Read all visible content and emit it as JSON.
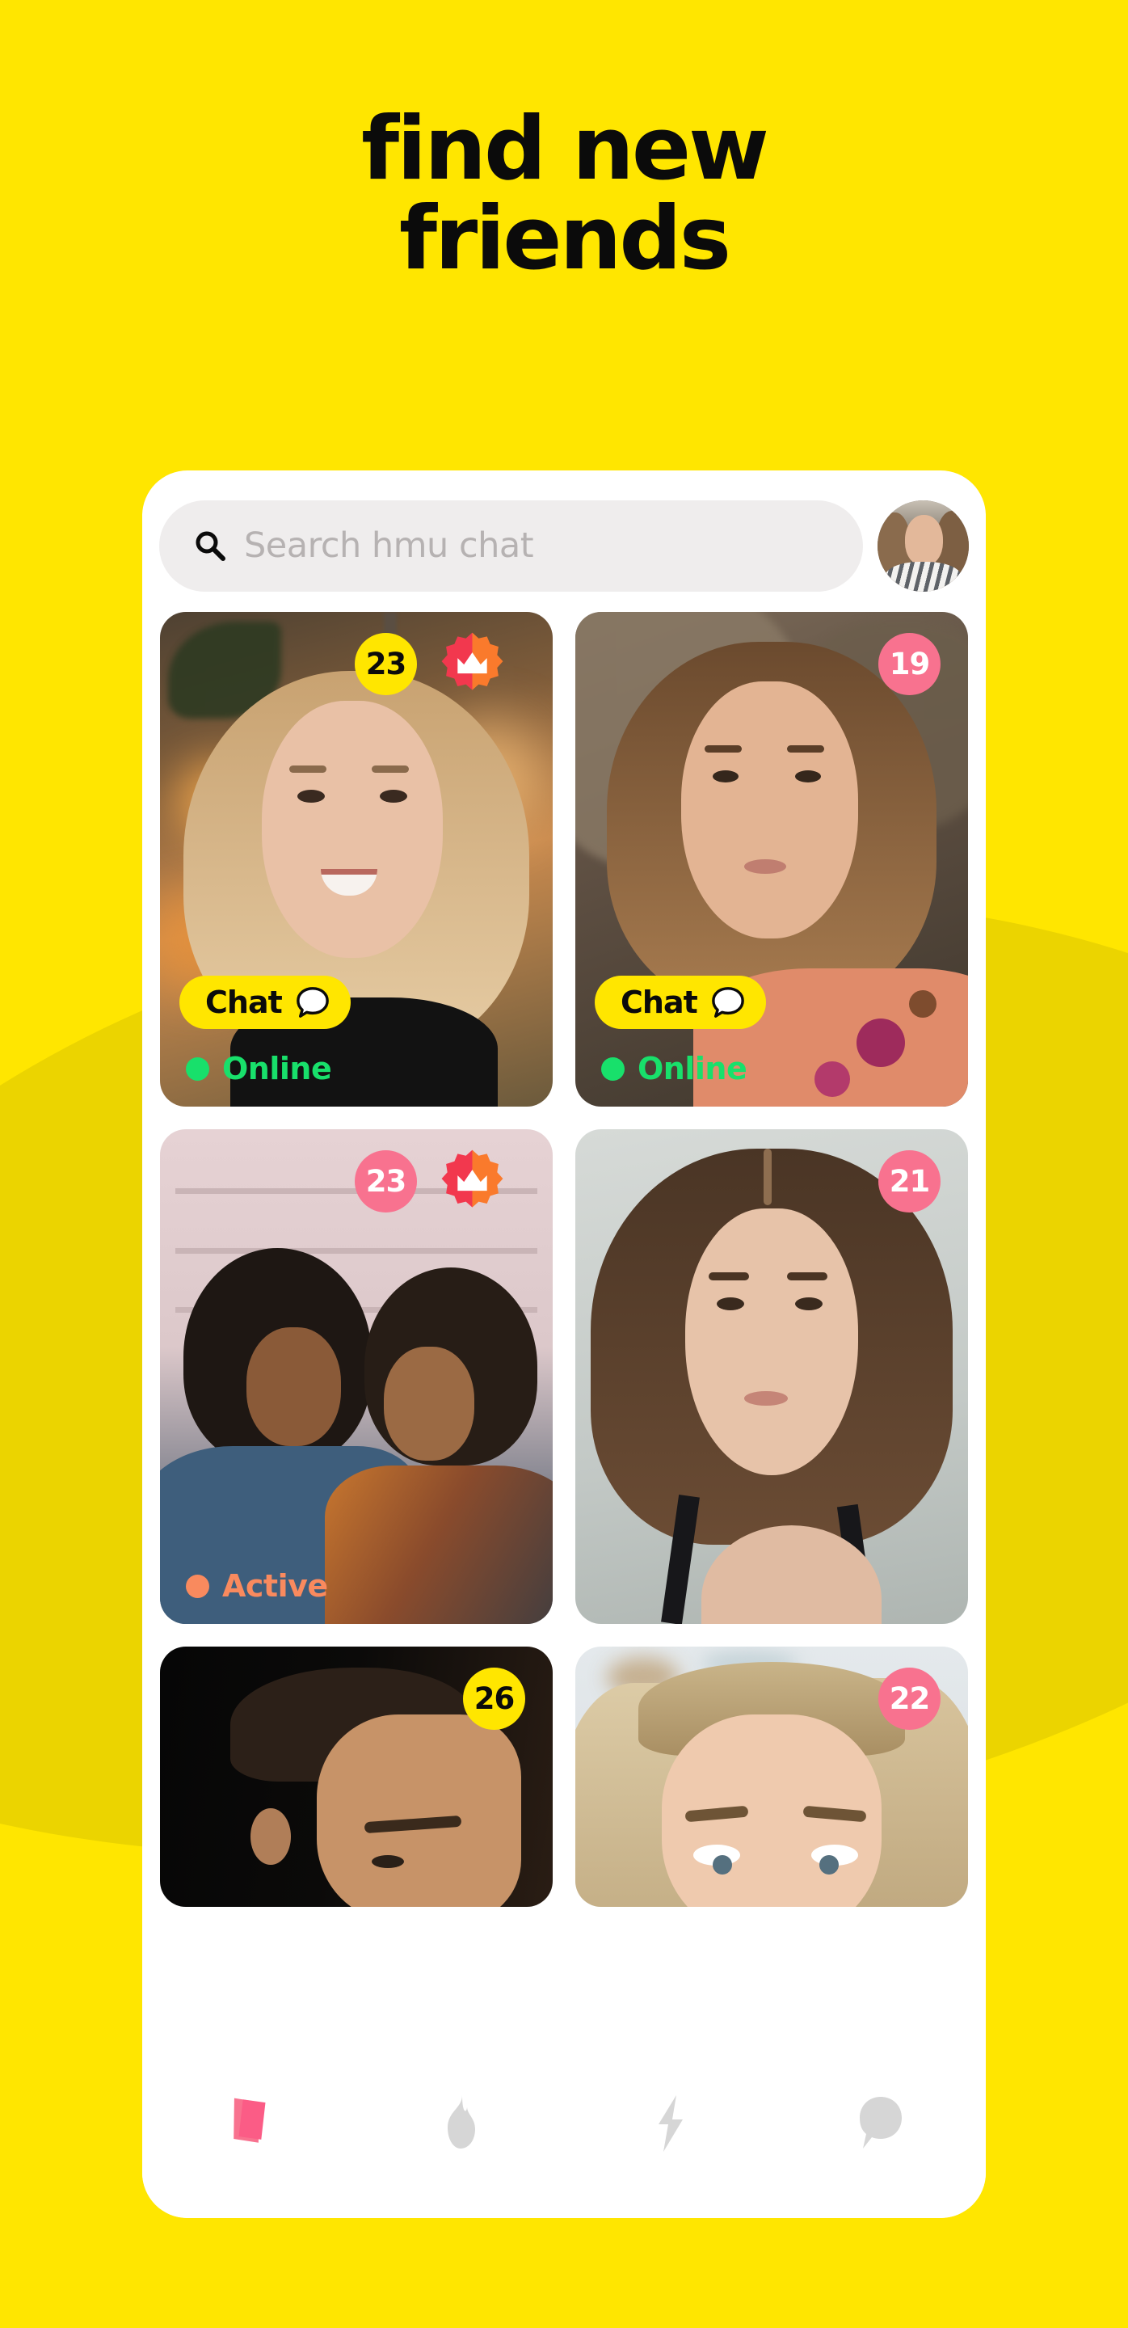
{
  "theme": {
    "background": "#FFE600",
    "background_blob": "#EBD400",
    "card_surface": "#FFFFFF",
    "accent_yellow": "#FFE600",
    "accent_pink": "#F8728F",
    "online_green": "#18E06B",
    "active_orange": "#F98A5E",
    "text_dark": "#0B0B0B",
    "placeholder_grey": "#B6B2B2",
    "search_field_bg": "#EFEDED",
    "nav_inactive": "#D6D6D6",
    "nav_active_pink": "#F8728F"
  },
  "headline": {
    "line1": "find new",
    "line2": "friends"
  },
  "search": {
    "icon": "search-icon",
    "placeholder": "Search hmu chat",
    "value": ""
  },
  "profile_avatar": {
    "icon": "avatar"
  },
  "chat_button": {
    "label": "Chat",
    "icon": "speech-bubble-icon"
  },
  "cards": [
    {
      "age": "23",
      "age_badge_style": "yellow",
      "verified": true,
      "verified_icon": "crown-badge-icon",
      "has_chat_button": true,
      "status": "Online",
      "status_type": "online"
    },
    {
      "age": "19",
      "age_badge_style": "pink",
      "verified": false,
      "has_chat_button": true,
      "status": "Online",
      "status_type": "online"
    },
    {
      "age": "23",
      "age_badge_style": "pink",
      "verified": true,
      "verified_icon": "crown-badge-icon",
      "has_chat_button": false,
      "status": "Active",
      "status_type": "active"
    },
    {
      "age": "21",
      "age_badge_style": "pink",
      "verified": false,
      "has_chat_button": false,
      "status": "",
      "status_type": "none"
    },
    {
      "age": "26",
      "age_badge_style": "yellow",
      "verified": false,
      "has_chat_button": false,
      "status": "",
      "status_type": "none"
    },
    {
      "age": "22",
      "age_badge_style": "pink",
      "verified": false,
      "has_chat_button": false,
      "status": "",
      "status_type": "none"
    }
  ],
  "bottom_nav": [
    {
      "icon": "cards-stack-icon",
      "active": true
    },
    {
      "icon": "flame-icon",
      "active": false
    },
    {
      "icon": "lightning-bolt-icon",
      "active": false
    },
    {
      "icon": "speech-bubble-icon",
      "active": false
    }
  ]
}
